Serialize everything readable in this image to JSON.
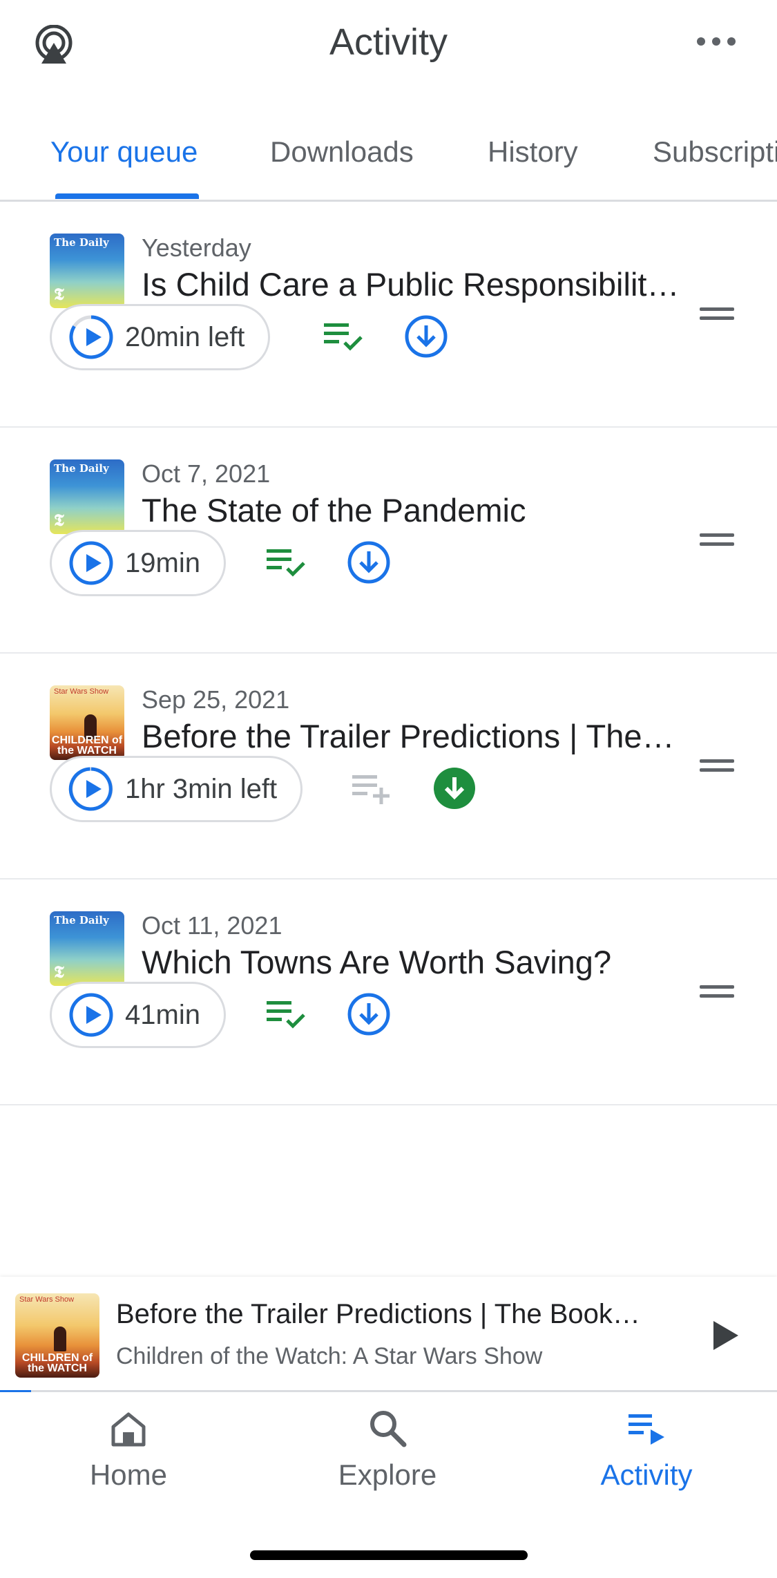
{
  "header": {
    "title": "Activity",
    "cast_icon": "cast-icon",
    "more_icon": "more-horizontal-icon"
  },
  "tabs": [
    {
      "label": "Your queue",
      "active": true
    },
    {
      "label": "Downloads",
      "active": false
    },
    {
      "label": "History",
      "active": false
    },
    {
      "label": "Subscriptions",
      "active": false
    }
  ],
  "episodes": [
    {
      "date": "Yesterday",
      "title": "Is Child Care a Public Responsibility?",
      "time": "20min left",
      "in_queue": true,
      "downloaded": false,
      "podcast_art": {
        "top": "The Daily",
        "bottom": "𝕿"
      }
    },
    {
      "date": "Oct 7, 2021",
      "title": "The State of the Pandemic",
      "time": "19min",
      "in_queue": true,
      "downloaded": false,
      "podcast_art": {
        "top": "The Daily",
        "bottom": "𝕿"
      }
    },
    {
      "date": "Sep 25, 2021",
      "title": "Before the Trailer Predictions | The Book of Boba Fett",
      "time": "1hr 3min left",
      "in_queue": false,
      "downloaded": true,
      "podcast_art": {
        "top": "Star Wars Show",
        "bottom": "CHILDREN of the WATCH"
      }
    },
    {
      "date": "Oct 11, 2021",
      "title": "Which Towns Are Worth Saving?",
      "time": "41min",
      "in_queue": true,
      "downloaded": false,
      "podcast_art": {
        "top": "The Daily",
        "bottom": "𝕿"
      }
    }
  ],
  "mini_player": {
    "title": "Before the Trailer Predictions | The Book of Boba Fett",
    "podcast": "Children of the Watch: A Star Wars Show",
    "art_top": "Star Wars Show",
    "art_bottom": "CHILDREN of the WATCH",
    "progress": 0.04
  },
  "nav": [
    {
      "label": "Home",
      "icon": "home-icon",
      "active": false
    },
    {
      "label": "Explore",
      "icon": "search-icon",
      "active": false
    },
    {
      "label": "Activity",
      "icon": "queue-play-icon",
      "active": true
    }
  ],
  "colors": {
    "accent": "#1a73e8",
    "queued_green": "#1e8e3e",
    "downloaded_green": "#1e8e3e",
    "muted": "#5f6368"
  }
}
